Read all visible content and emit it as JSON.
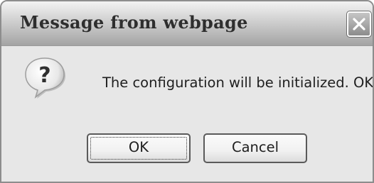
{
  "dialog": {
    "title": "Message from webpage",
    "message": "The configuration will be initialized. OK?",
    "icon": "question-icon",
    "buttons": {
      "ok_label": "OK",
      "cancel_label": "Cancel"
    },
    "close_icon": "close-icon"
  }
}
